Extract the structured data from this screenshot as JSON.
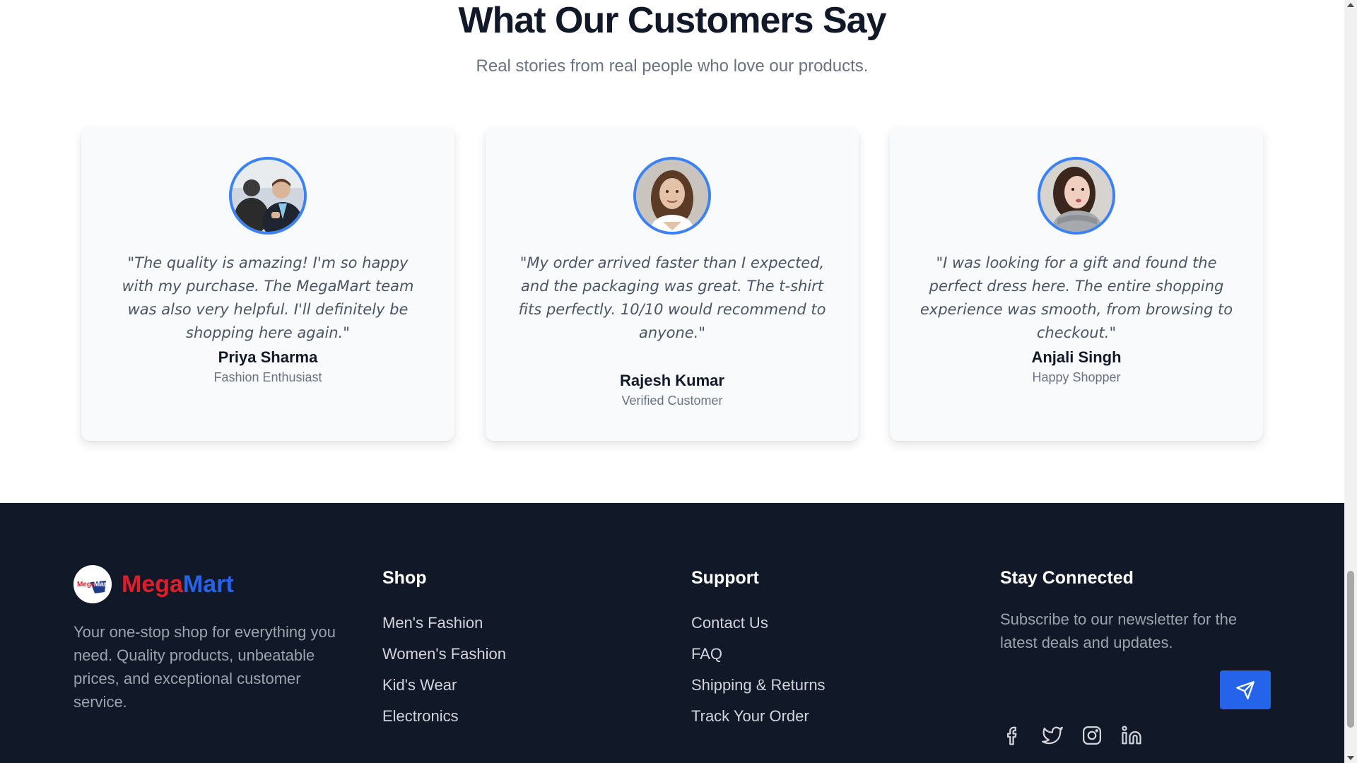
{
  "testimonials": {
    "title": "What Our Customers Say",
    "subtitle": "Real stories from real people who love our products.",
    "cards": [
      {
        "quote": "\"The quality is amazing! I'm so happy with my purchase. The MegaMart team was also very helpful. I'll definitely be shopping here again.\"",
        "name": "Priya Sharma",
        "role": "Fashion Enthusiast"
      },
      {
        "quote": "\"My order arrived faster than I expected, and the packaging was great. The t-shirt fits perfectly. 10/10 would recommend to anyone.\"",
        "name": "Rajesh Kumar",
        "role": "Verified Customer"
      },
      {
        "quote": "\"I was looking for a gift and found the perfect dress here. The entire shopping experience was smooth, from browsing to checkout.\"",
        "name": "Anjali Singh",
        "role": "Happy Shopper"
      }
    ]
  },
  "footer": {
    "brand": {
      "logo_text": "MegaMart",
      "logo_part1": "Mega",
      "logo_part2": "Mart",
      "description": "Your one-stop shop for everything you need. Quality products, unbeatable prices, and exceptional customer service."
    },
    "shop": {
      "title": "Shop",
      "links": [
        "Men's Fashion",
        "Women's Fashion",
        "Kid's Wear",
        "Electronics"
      ]
    },
    "support": {
      "title": "Support",
      "links": [
        "Contact Us",
        "FAQ",
        "Shipping & Returns",
        "Track Your Order"
      ]
    },
    "stay_connected": {
      "title": "Stay Connected",
      "description": "Subscribe to our newsletter for the latest deals and updates.",
      "send_icon": "send-icon",
      "socials": [
        "facebook-icon",
        "twitter-icon",
        "instagram-icon",
        "linkedin-icon"
      ]
    }
  },
  "colors": {
    "accent": "#2563eb",
    "footer_bg": "#111827",
    "brand_red": "#e11d2a",
    "avatar_border": "#3b82f6"
  }
}
